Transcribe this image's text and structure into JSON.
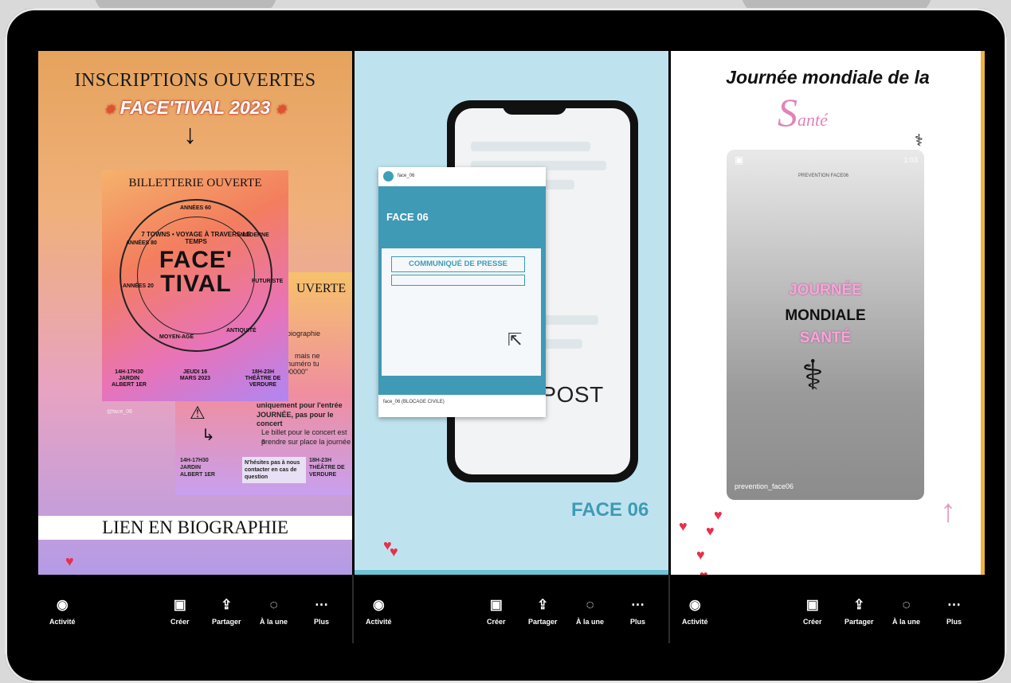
{
  "panels": [
    {
      "title": "INSCRIPTIONS OUVERTES",
      "subtitle": "FACE'TIVAL 2023",
      "arrow": "↓",
      "poster_back": {
        "title": "UVERTE",
        "lines": [
          "biographie",
          "mais ne",
          "numéro tu",
          "00000\"",
          "uniquement pour l'entrée",
          "JOURNÉE, pas pour le concert",
          "Le billet pour le concert est a",
          "prendre sur place la journée"
        ],
        "footer": [
          "14H-17H30 JARDIN ALBERT 1ER",
          "N'hésites pas à nous contacter en cas de question",
          "18H-23H THÉÂTRE DE VERDURE"
        ]
      },
      "poster_front": {
        "title": "BILLETTERIE OUVERTE",
        "wheel_title": "FACE' TIVAL",
        "wheel_ring": "7 TOWNS • VOYAGE À TRAVERS LE TEMPS",
        "ring_labels": [
          "ANNÉES 60",
          "MODERNE",
          "FUTURISTE",
          "ANTIQUITÉ",
          "MOYEN-AGE",
          "ANNÉES 20",
          "ANNÉES 80"
        ],
        "footer": [
          "14H-17H30 JARDIN ALBERT 1ER",
          "JEUDI 16 MARS 2023",
          "18H-23H THÉÂTRE DE VERDURE"
        ]
      },
      "handle": "@face_06",
      "banner": "LIEN EN BIOGRAPHIE"
    },
    {
      "card_handle": "face_06",
      "card_face": "FACE 06",
      "card_press": "COMMUNIQUÉ DE PRESSE",
      "card_footer": "face_06 (BLOCAGE CIVILE)",
      "new_post": "NEW POST",
      "logo": "FACE 06"
    },
    {
      "title": "Journée mondiale de la",
      "sante_initial": "S",
      "sante_rest": "anté",
      "story": {
        "time": "1:03",
        "logo": "PREVENTION FACE06",
        "line1": "JOURNÉE",
        "line2": "MONDIALE",
        "line3": "SANTÉ",
        "user": "prevention_face06"
      }
    }
  ],
  "actions": [
    {
      "icon": "eye-icon",
      "label": "Activité"
    },
    {
      "icon": "reels-icon",
      "label": "Créer"
    },
    {
      "icon": "share-icon",
      "label": "Partager"
    },
    {
      "icon": "highlight-icon",
      "label": "À la une"
    },
    {
      "icon": "more-icon",
      "label": "Plus"
    }
  ],
  "colors": {
    "heart": "#e8304a",
    "teal": "#3f9ab5",
    "pink": "#e283b8",
    "accent_border": "#f2b33a"
  }
}
